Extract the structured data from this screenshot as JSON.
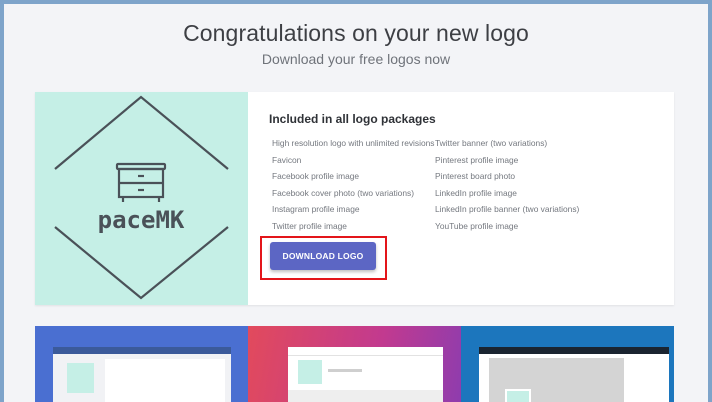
{
  "header": {
    "title": "Congratulations on your new logo",
    "subtitle": "Download your free logos now"
  },
  "logo": {
    "brand_text": "paceMK",
    "icon": "dresser-icon",
    "background_color": "#c5efe6",
    "ink_color": "#4a5158"
  },
  "package": {
    "title": "Included in all logo packages",
    "features_left": [
      "High resolution logo with unlimited revisions",
      "Favicon",
      "Facebook profile image",
      "Facebook cover photo (two variations)",
      "Instagram profile image",
      "Twitter profile image"
    ],
    "features_right": [
      "Twitter banner (two variations)",
      "Pinterest profile image",
      "Pinterest board photo",
      "LinkedIn profile image",
      "LinkedIn profile banner (two variations)",
      "YouTube profile image"
    ],
    "download_label": "DOWNLOAD LOGO",
    "button_color": "#5c66c4",
    "highlight_color": "#e3151a"
  },
  "previews": {
    "facebook_color": "#4a6fd1",
    "instagram_color": "#d2407a",
    "twitter_color": "#1c76bd"
  }
}
